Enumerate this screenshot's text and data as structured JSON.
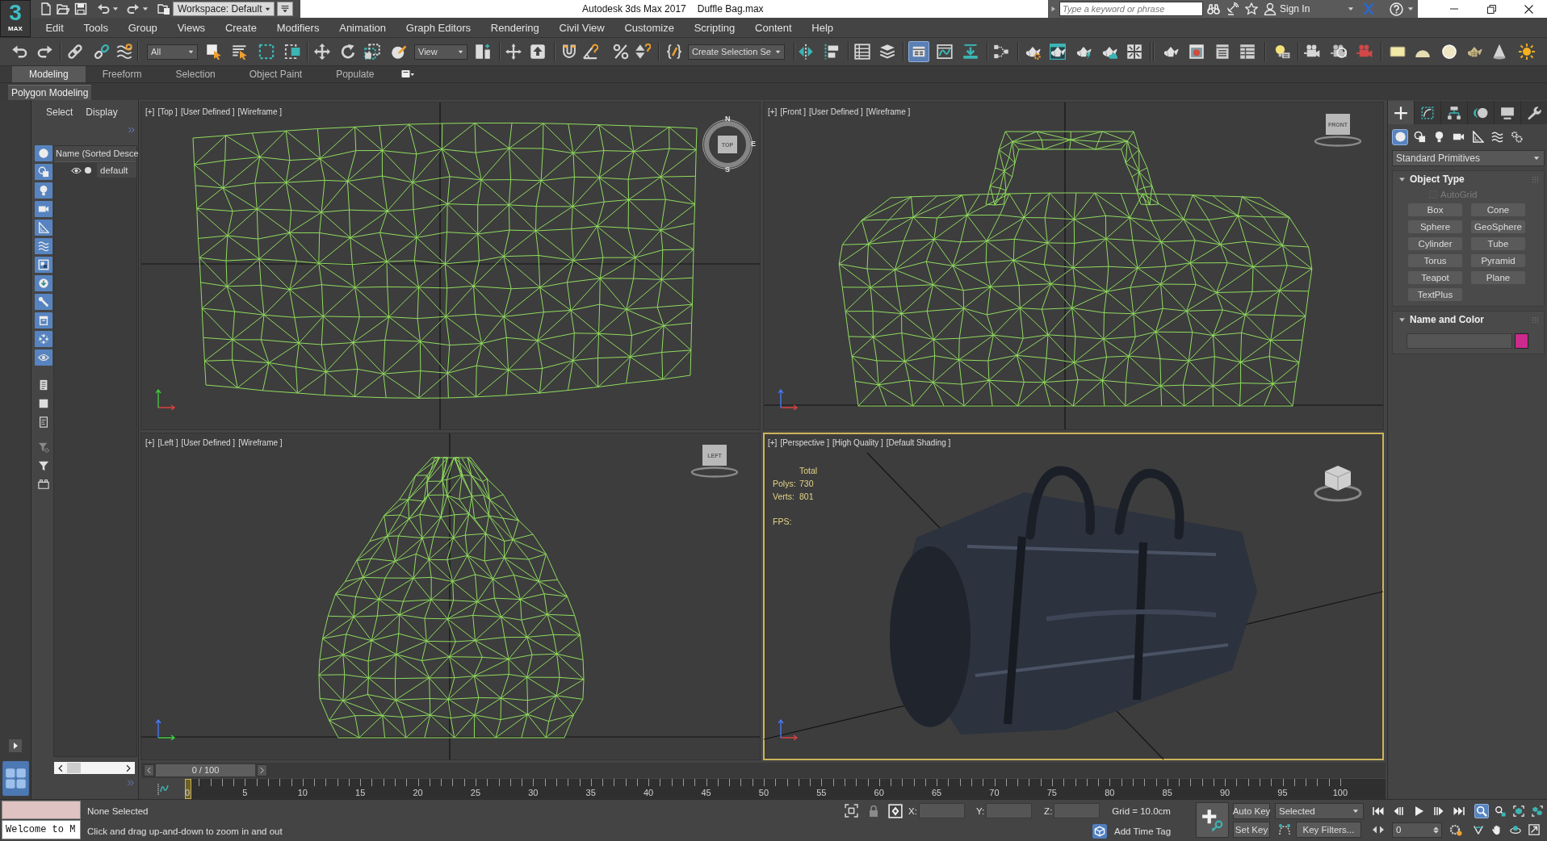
{
  "logo": {
    "glyph": "3",
    "label": "MAX"
  },
  "title_bar": {
    "workspace": "Workspace: Default",
    "app_title": "Autodesk 3ds Max 2017",
    "file_name": "Duffle Bag.max",
    "search": {
      "placeholder": "Type a keyword or phrase"
    },
    "sign_in": "Sign In"
  },
  "menu": [
    "Edit",
    "Tools",
    "Group",
    "Views",
    "Create",
    "Modifiers",
    "Animation",
    "Graph Editors",
    "Rendering",
    "Civil View",
    "Customize",
    "Scripting",
    "Content",
    "Help"
  ],
  "main_toolbar": {
    "selection_filter": "All",
    "reference_coordinate": "View",
    "named_selection": "Create Selection Se",
    "ribbon_toggle": {
      "on": true
    }
  },
  "ribbon": {
    "tabs": [
      {
        "label": "Modeling",
        "selected": true
      },
      {
        "label": "Freeform",
        "selected": false
      },
      {
        "label": "Selection",
        "selected": false
      },
      {
        "label": "Object Paint",
        "selected": false
      },
      {
        "label": "Populate",
        "selected": false
      }
    ],
    "panel": "Polygon Modeling"
  },
  "scene_explorer": {
    "menus": [
      "Select",
      "Display"
    ],
    "filters": [
      {
        "on": true
      },
      {
        "on": true
      },
      {
        "on": true
      },
      {
        "on": true
      },
      {
        "on": true
      },
      {
        "on": true
      },
      {
        "on": true
      },
      {
        "on": true
      },
      {
        "on": true
      },
      {
        "on": true
      },
      {
        "on": true
      },
      {
        "on": true
      },
      {
        "on": false
      },
      {
        "on": false
      },
      {
        "on": false
      },
      {
        "on": false
      },
      {
        "on": false
      },
      {
        "on": false
      }
    ],
    "column": "Name (Sorted Desce",
    "rows": [
      {
        "name": "default"
      }
    ]
  },
  "viewports": [
    {
      "kind": "top",
      "menus": [
        "[+]",
        "[Top ]",
        "[User Defined ]",
        "[Wireframe ]"
      ],
      "active": false,
      "cube_label": "TOP",
      "compass": [
        "N",
        "E",
        "S"
      ]
    },
    {
      "kind": "front",
      "menus": [
        "[+]",
        "[Front ]",
        "[User Defined ]",
        "[Wireframe ]"
      ],
      "active": false,
      "cube_label": "FRONT"
    },
    {
      "kind": "left",
      "menus": [
        "[+]",
        "[Left ]",
        "[User Defined ]",
        "[Wireframe ]"
      ],
      "active": false,
      "cube_label": "LEFT"
    },
    {
      "kind": "perspective",
      "menus": [
        "[+]",
        "[Perspective ]",
        "[High Quality ]",
        "[Default Shading ]"
      ],
      "active": true,
      "stats": {
        "heading": "Total",
        "rows": [
          {
            "label": "Polys:",
            "value": "730"
          },
          {
            "label": "Verts:",
            "value": "801"
          }
        ],
        "fps_label": "FPS:"
      }
    }
  ],
  "command_panel": {
    "tabs": [
      {
        "selected": true
      },
      {
        "selected": false
      },
      {
        "selected": false
      },
      {
        "selected": false
      },
      {
        "selected": false
      },
      {
        "selected": false
      }
    ],
    "categories": [
      {
        "selected": true
      },
      {
        "selected": false
      },
      {
        "selected": false
      },
      {
        "selected": false
      },
      {
        "selected": false
      },
      {
        "selected": false
      },
      {
        "selected": false
      }
    ],
    "dropdown": "Standard Primitives",
    "rollouts": [
      {
        "kind": "object_type",
        "title": "Object Type",
        "expanded": true,
        "autogrid": {
          "label": "AutoGrid",
          "checked": false,
          "disabled": true
        },
        "buttons": [
          "Box",
          "Cone",
          "Sphere",
          "GeoSphere",
          "Cylinder",
          "Tube",
          "Torus",
          "Pyramid",
          "Teapot",
          "Plane",
          "TextPlus"
        ]
      },
      {
        "kind": "name_color",
        "title": "Name and Color",
        "expanded": true,
        "color": "#cc2a8c"
      }
    ]
  },
  "time_slider": {
    "label": "0 / 100",
    "level": 0
  },
  "track_bar": {
    "ticks": [
      "0",
      "5",
      "10",
      "15",
      "20",
      "25",
      "30",
      "35",
      "40",
      "45",
      "50",
      "55",
      "60",
      "65",
      "70",
      "75",
      "80",
      "85",
      "90",
      "95",
      "100"
    ]
  },
  "status_bar": {
    "listener": "Welcome to M",
    "selection": "None Selected",
    "prompt": "Click and drag up-and-down to zoom in and out",
    "coordinates": [
      "X:",
      "Y:",
      "Z:"
    ],
    "grid": "Grid = 10.0cm",
    "time_tag": "Add Time Tag"
  },
  "animation_controls": {
    "auto_key": "Auto Key",
    "key_set": "Selected",
    "set_key": "Set Key",
    "key_filters": "Key Filters...",
    "frame": "0"
  },
  "navigation": [
    {
      "selected": true
    },
    {
      "selected": false
    },
    {
      "selected": false
    },
    {
      "selected": false
    },
    {
      "selected": false
    },
    {
      "selected": false
    },
    {
      "selected": false
    },
    {
      "selected": false
    }
  ]
}
